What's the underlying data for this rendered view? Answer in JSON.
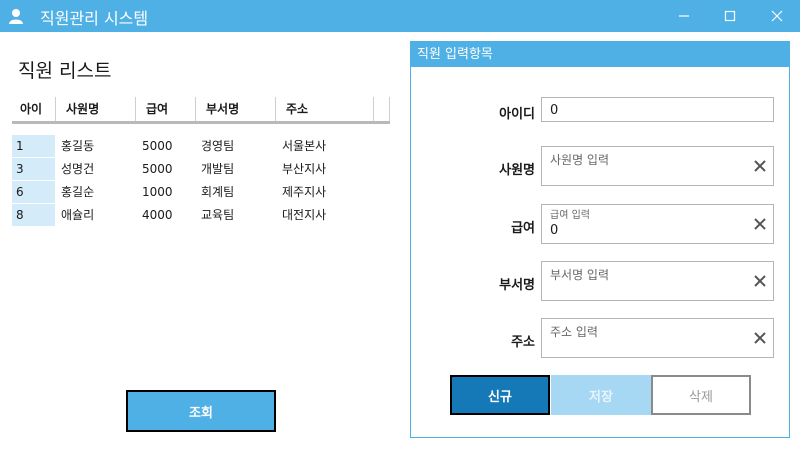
{
  "window": {
    "title": "직원관리 시스템",
    "icon": "user-icon",
    "accent": "#4fb0e5"
  },
  "list": {
    "title": "직원 리스트",
    "columns": [
      "아이",
      "사원명",
      "급여",
      "부서명",
      "주소"
    ],
    "rows": [
      {
        "id": "1",
        "name": "홍길동",
        "salary": "5000",
        "dept": "경영팀",
        "address": "서울본사"
      },
      {
        "id": "3",
        "name": "성명건",
        "salary": "5000",
        "dept": "개발팀",
        "address": "부산지사"
      },
      {
        "id": "6",
        "name": "홍길순",
        "salary": "1000",
        "dept": "회계팀",
        "address": "제주지사"
      },
      {
        "id": "8",
        "name": "애슐리",
        "salary": "4000",
        "dept": "교육팀",
        "address": "대전지사"
      }
    ],
    "search_button": "조회"
  },
  "form": {
    "title": "직원 입력항목",
    "id_label": "아이디",
    "id_value": "0",
    "name_label": "사원명",
    "name_placeholder": "사원명 입력",
    "salary_label": "급여",
    "salary_hint": "급여 입력",
    "salary_value": "0",
    "dept_label": "부서명",
    "dept_placeholder": "부서명 입력",
    "addr_label": "주소",
    "addr_placeholder": "주소 입력",
    "buttons": {
      "new": "신규",
      "save": "저장",
      "delete": "삭제"
    }
  }
}
